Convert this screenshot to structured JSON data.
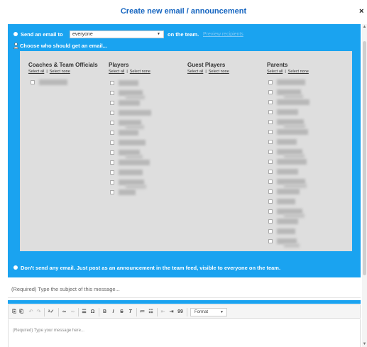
{
  "dialog": {
    "title": "Create new email / announcement",
    "close_label": "×"
  },
  "send_row": {
    "prefix": "Send an email to",
    "selected_recipients": "everyone",
    "suffix": "on the team.",
    "preview_link": "Preview recipients"
  },
  "choose_row": {
    "label": "Choose who should get an email..."
  },
  "groups": [
    {
      "heading": "Coaches & Team Officials",
      "select_all": "Select all",
      "select_none": "Select none",
      "member_count": 1
    },
    {
      "heading": "Players",
      "select_all": "Select all",
      "select_none": "Select none",
      "member_count": 12
    },
    {
      "heading": "Guest Players",
      "select_all": "Select all",
      "select_none": "Select none",
      "member_count": 0
    },
    {
      "heading": "Parents",
      "select_all": "Select all",
      "select_none": "Select none",
      "member_count": 17
    }
  ],
  "announce_row": {
    "label": "Don't send any email. Just post as an announcement in the team feed, visible to everyone on the team."
  },
  "subject": {
    "placeholder": "(Required) Type the subject of this message..."
  },
  "editor": {
    "format_label": "Format",
    "body_placeholder": "(Required) Type your message here..."
  },
  "colors": {
    "accent": "#1aa3f0",
    "title": "#1565c0",
    "recipient_panel": "#dedede"
  }
}
